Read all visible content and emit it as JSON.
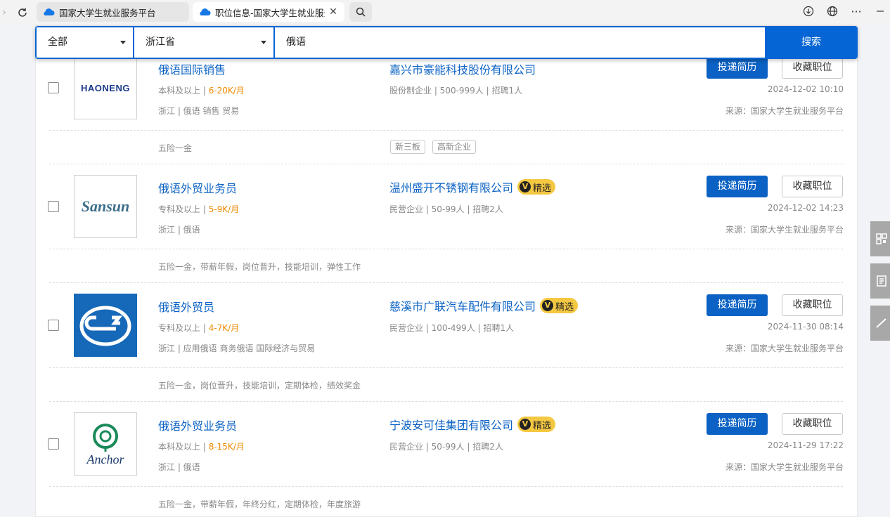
{
  "browser": {
    "tabs": [
      {
        "title": "国家大学生就业服务平台"
      },
      {
        "title": "职位信息-国家大学生就业服务"
      }
    ],
    "icons": [
      "back-arrow-icon",
      "reload-icon",
      "cloud-icon",
      "close-icon",
      "search-icon",
      "download-icon",
      "globe-icon",
      "more-icon",
      "minimize-icon"
    ]
  },
  "search": {
    "category": "全部",
    "province": "浙江省",
    "query": "俄语",
    "button": "搜索"
  },
  "colors": {
    "accent": "#0565d4",
    "link": "#0b62c4",
    "salary": "#f08a00",
    "badge": "#f5c842"
  },
  "jobs": [
    {
      "title": "俄语国际销售",
      "edu": "本科及以上",
      "salary": "6-20K/月",
      "tags": "浙江 | 俄语 销售 贸易",
      "company": "嘉兴市豪能科技股份有限公司",
      "featured": false,
      "company_meta": "股份制企业 | 500-999人 | 招聘1人",
      "date": "2024-12-02  10:10",
      "source": "来源：国家大学生就业服务平台",
      "benefits": "五险一金",
      "company_tags": [
        "新三板",
        "高新企业"
      ],
      "logo_text": "HAONENG",
      "apply": "投递简历",
      "fav": "收藏职位"
    },
    {
      "title": "俄语外贸业务员",
      "edu": "专科及以上",
      "salary": "5-9K/月",
      "tags": "浙江 | 俄语",
      "company": "温州盛开不锈钢有限公司",
      "featured": true,
      "badge": "精选",
      "company_meta": "民营企业 | 50-99人 | 招聘2人",
      "date": "2024-12-02  14:23",
      "source": "来源：国家大学生就业服务平台",
      "benefits": "五险一金，带薪年假，岗位晋升，技能培训，弹性工作",
      "logo_text": "Sansun",
      "apply": "投递简历",
      "fav": "收藏职位"
    },
    {
      "title": "俄语外贸员",
      "edu": "专科及以上",
      "salary": "4-7K/月",
      "tags": "浙江 | 应用俄语 商务俄语 国际经济与贸易",
      "company": "慈溪市广联汽车配件有限公司",
      "featured": true,
      "badge": "精选",
      "company_meta": "民营企业 | 100-499人 | 招聘1人",
      "date": "2024-11-30  08:14",
      "source": "来源：国家大学生就业服务平台",
      "benefits": "五险一金，岗位晋升，技能培训，定期体检，绩效奖金",
      "apply": "投递简历",
      "fav": "收藏职位"
    },
    {
      "title": "俄语外贸业务员",
      "edu": "本科及以上",
      "salary": "8-15K/月",
      "tags": "浙江 | 俄语",
      "company": "宁波安可佳集团有限公司",
      "featured": true,
      "badge": "精选",
      "company_meta": "民营企业 | 50-99人 | 招聘2人",
      "date": "2024-11-29  17:22",
      "source": "来源：国家大学生就业服务平台",
      "benefits": "五险一金，带薪年假，年终分红，定期体检，年度旅游",
      "logo_text": "Anchor",
      "apply": "投递简历",
      "fav": "收藏职位"
    }
  ]
}
